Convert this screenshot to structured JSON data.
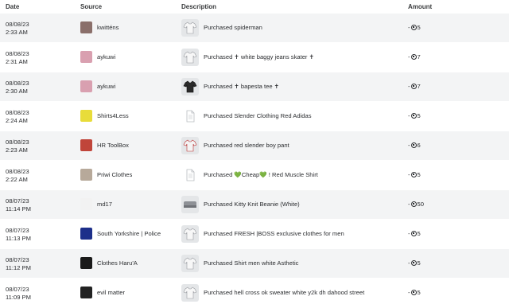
{
  "columns": {
    "date": "Date",
    "source": "Source",
    "description": "Description",
    "amount": "Amount"
  },
  "rows": [
    {
      "date": "08/08/23",
      "time": "2:33 AM",
      "source": "kwitténs",
      "description": "Purchased spiderman",
      "sign": "-",
      "amount": "5",
      "source_color": "#8a6f6a",
      "thumb": "shirt"
    },
    {
      "date": "08/08/23",
      "time": "2:31 AM",
      "source": "aykuwi",
      "description": "Purchased ✝ white baggy jeans skater ✝",
      "sign": "-",
      "amount": "7",
      "source_color": "#d9a0b0",
      "thumb": "shirt"
    },
    {
      "date": "08/08/23",
      "time": "2:30 AM",
      "source": "aykuwi",
      "description": "Purchased ✝ bapesta tee ✝",
      "sign": "-",
      "amount": "7",
      "source_color": "#d9a0b0",
      "thumb": "shirt-dark"
    },
    {
      "date": "08/08/23",
      "time": "2:24 AM",
      "source": "Shirts4Less",
      "description": "Purchased Slender Clothing Red Adidas",
      "sign": "-",
      "amount": "5",
      "source_color": "#e8dc3a",
      "thumb": "doc"
    },
    {
      "date": "08/08/23",
      "time": "2:23 AM",
      "source": "HR ToolBox",
      "description": "Purchased red slender boy pant",
      "sign": "-",
      "amount": "6",
      "source_color": "#c0453a",
      "thumb": "shirt-red"
    },
    {
      "date": "08/08/23",
      "time": "2:22 AM",
      "source": "Priwi Clothes",
      "description": "Purchased 💚Cheap💚 ! Red Muscle Shirt",
      "sign": "-",
      "amount": "5",
      "source_color": "#b7a99a",
      "thumb": "doc"
    },
    {
      "date": "08/07/23",
      "time": "11:14 PM",
      "source": "md17",
      "description": "Purchased Kitty Knit Beanie (White)",
      "sign": "-",
      "amount": "50",
      "source_color": "#f2f2f2",
      "thumb": "beanie"
    },
    {
      "date": "08/07/23",
      "time": "11:13 PM",
      "source": "South Yorkshire | Police",
      "description": "Purchased FRESH |BOSS exclusive clothes for men",
      "sign": "-",
      "amount": "5",
      "source_color": "#1d2f8a",
      "thumb": "shirt"
    },
    {
      "date": "08/07/23",
      "time": "11:12 PM",
      "source": "Clothes Haru'A",
      "description": "Purchased Shirt men white Asthetic",
      "sign": "-",
      "amount": "5",
      "source_color": "#1a1a1a",
      "thumb": "shirt"
    },
    {
      "date": "08/07/23",
      "time": "11:09 PM",
      "source": "evil matter",
      "description": "Purchased hell cross ok sweater white y2k dh dahood street",
      "sign": "-",
      "amount": "5",
      "source_color": "#222222",
      "thumb": "shirt"
    }
  ]
}
